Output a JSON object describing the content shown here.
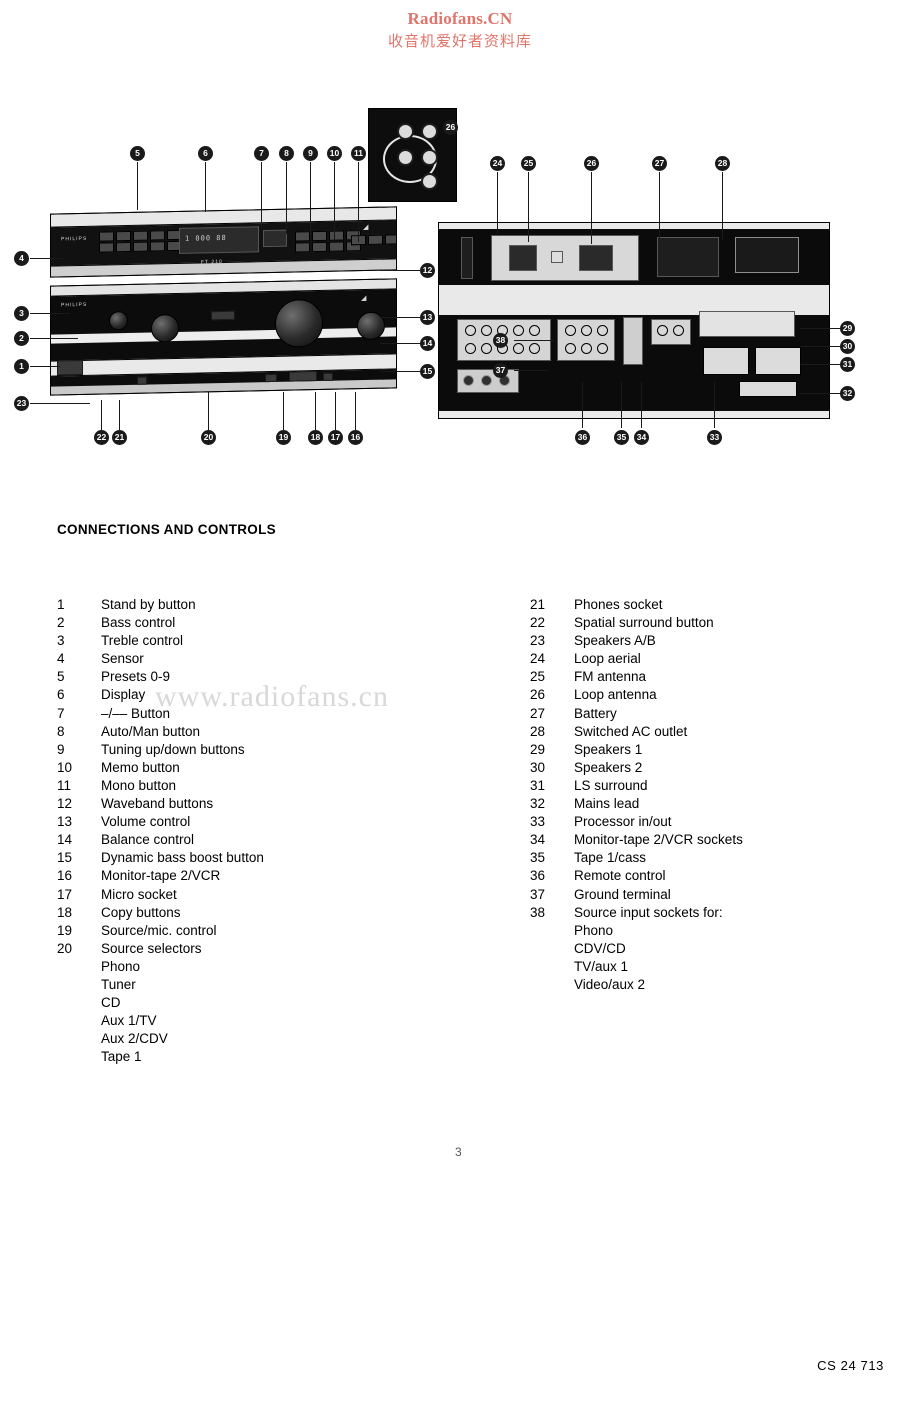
{
  "watermark": {
    "top_line1": "Radiofans.CN",
    "top_line2": "收音机爱好者资料库",
    "middle": "www.radiofans.cn"
  },
  "section": {
    "title": "CONNECTIONS AND CONTROLS"
  },
  "figure": {
    "brand": "PHILIPS",
    "model": "FT 210",
    "lcd_text": "1 000  88",
    "callouts_left": [
      "1",
      "2",
      "3",
      "4"
    ],
    "callouts_top_left": [
      "5",
      "6",
      "7",
      "8",
      "9",
      "10",
      "11"
    ],
    "callouts_right_front": [
      "12",
      "13",
      "14",
      "15"
    ],
    "callouts_bottom_front": [
      "16",
      "17",
      "18",
      "19",
      "20",
      "21",
      "22",
      "23"
    ],
    "callouts_top_rear": [
      "24",
      "25",
      "26",
      "27",
      "28"
    ],
    "callouts_inset": [
      "26"
    ],
    "callouts_right_rear": [
      "29",
      "30",
      "31",
      "32"
    ],
    "callouts_bottom_rear": [
      "33",
      "34",
      "35",
      "36"
    ],
    "callouts_left_rear": [
      "37",
      "38"
    ]
  },
  "list_left": [
    {
      "num": "1",
      "text": "Stand by button"
    },
    {
      "num": "2",
      "text": "Bass control"
    },
    {
      "num": "3",
      "text": "Treble control"
    },
    {
      "num": "4",
      "text": "Sensor"
    },
    {
      "num": "5",
      "text": "Presets 0-9"
    },
    {
      "num": "6",
      "text": "Display"
    },
    {
      "num": "7",
      "text": "–/–– Button"
    },
    {
      "num": "8",
      "text": "Auto/Man button"
    },
    {
      "num": "9",
      "text": "Tuning up/down buttons"
    },
    {
      "num": "10",
      "text": "Memo button"
    },
    {
      "num": "11",
      "text": "Mono button"
    },
    {
      "num": "12",
      "text": "Waveband buttons"
    },
    {
      "num": "13",
      "text": "Volume control"
    },
    {
      "num": "14",
      "text": "Balance control"
    },
    {
      "num": "15",
      "text": "Dynamic bass boost button"
    },
    {
      "num": "16",
      "text": "Monitor-tape 2/VCR"
    },
    {
      "num": "17",
      "text": "Micro socket"
    },
    {
      "num": "18",
      "text": "Copy buttons"
    },
    {
      "num": "19",
      "text": "Source/mic. control"
    },
    {
      "num": "20",
      "text": "Source selectors"
    },
    {
      "num": "",
      "text": "Phono"
    },
    {
      "num": "",
      "text": "Tuner"
    },
    {
      "num": "",
      "text": "CD"
    },
    {
      "num": "",
      "text": "Aux 1/TV"
    },
    {
      "num": "",
      "text": "Aux 2/CDV"
    },
    {
      "num": "",
      "text": "Tape 1"
    }
  ],
  "list_right": [
    {
      "num": "21",
      "text": "Phones socket"
    },
    {
      "num": "22",
      "text": "Spatial surround button"
    },
    {
      "num": "23",
      "text": "Speakers A/B"
    },
    {
      "num": "24",
      "text": "Loop aerial"
    },
    {
      "num": "25",
      "text": "FM antenna"
    },
    {
      "num": "26",
      "text": "Loop antenna"
    },
    {
      "num": "27",
      "text": "Battery"
    },
    {
      "num": "28",
      "text": "Switched AC outlet"
    },
    {
      "num": "29",
      "text": "Speakers 1"
    },
    {
      "num": "30",
      "text": "Speakers 2"
    },
    {
      "num": "31",
      "text": "LS surround"
    },
    {
      "num": "32",
      "text": "Mains lead"
    },
    {
      "num": "33",
      "text": "Processor in/out"
    },
    {
      "num": "34",
      "text": "Monitor-tape 2/VCR sockets"
    },
    {
      "num": "35",
      "text": "Tape 1/cass"
    },
    {
      "num": "36",
      "text": "Remote control"
    },
    {
      "num": "37",
      "text": "Ground terminal"
    },
    {
      "num": "38",
      "text": "Source input sockets for:"
    },
    {
      "num": "",
      "text": "Phono"
    },
    {
      "num": "",
      "text": "CDV/CD"
    },
    {
      "num": "",
      "text": "TV/aux 1"
    },
    {
      "num": "",
      "text": "Video/aux 2"
    }
  ],
  "footer": {
    "code": "CS 24 713",
    "page": "3"
  }
}
